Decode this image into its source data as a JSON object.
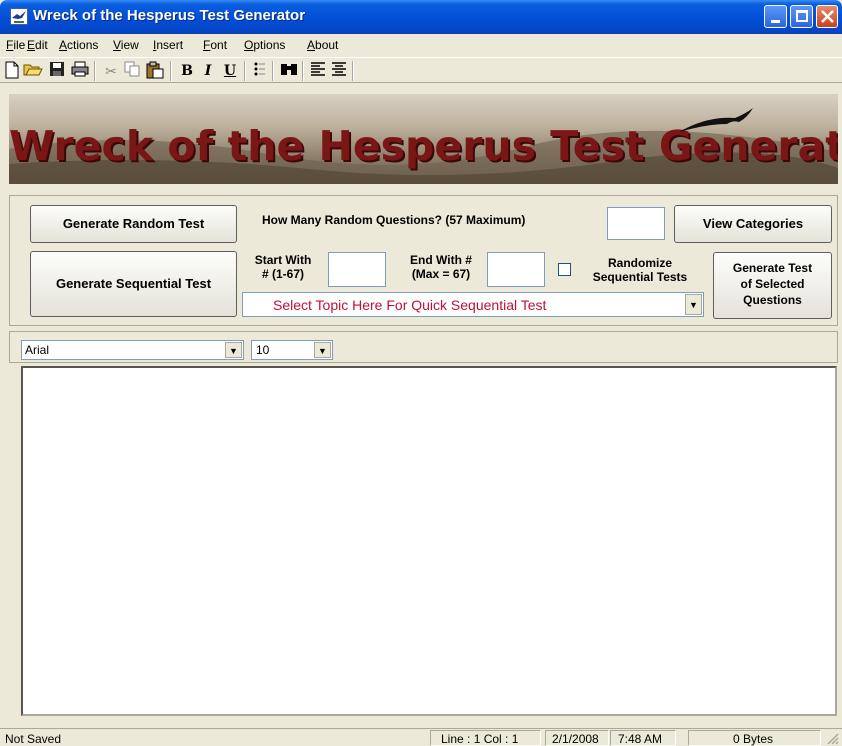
{
  "window": {
    "title": "Wreck of the Hesperus Test Generator"
  },
  "menu": [
    "File",
    "Edit",
    "Actions",
    "View",
    "Insert",
    "Font",
    "Options",
    "About"
  ],
  "toolbar": {
    "new_icon": "new-document-icon",
    "open_icon": "open-folder-icon",
    "save_icon": "save-disk-icon",
    "print_icon": "printer-icon",
    "cut_icon": "scissors-icon",
    "copy_icon": "copy-icon",
    "paste_icon": "paste-icon",
    "bold": "B",
    "italic": "I",
    "underline": "U",
    "bullets_icon": "bullet-list-icon",
    "find_icon": "binoculars-icon",
    "align_left_icon": "align-left-icon",
    "align_center_icon": "align-center-icon"
  },
  "banner": {
    "title": "Wreck of the Hesperus Test Generator"
  },
  "panel": {
    "generate_random": "Generate Random Test",
    "how_many_label": "How Many Random Questions? (57 Maximum)",
    "how_many_value": "",
    "view_categories": "View Categories",
    "generate_sequential": "Generate Sequential Test",
    "start_with_line1": "Start With",
    "start_with_line2": "# (1-67)",
    "start_value": "",
    "end_with_line1": "End With #",
    "end_with_line2": "(Max = 67)",
    "end_value": "",
    "randomize_line1": "Randomize",
    "randomize_line2": "Sequential Tests",
    "randomize_checked": false,
    "topic_placeholder": "Select Topic Here For Quick Sequential Test",
    "generate_selected_line1": "Generate Test",
    "generate_selected_line2": "of Selected",
    "generate_selected_line3": "Questions"
  },
  "fontbar": {
    "font": "Arial",
    "size": "10"
  },
  "editor": {
    "content": ""
  },
  "status": {
    "saved": "Not Saved",
    "line_col": "Line : 1   Col : 1",
    "date": "2/1/2008",
    "time": "7:48 AM",
    "bytes": "0 Bytes"
  },
  "colors": {
    "titlebar": "#0a5fe0",
    "banner_title": "#7a1616",
    "topic_text": "#c0103a",
    "face": "#ece9d8"
  }
}
